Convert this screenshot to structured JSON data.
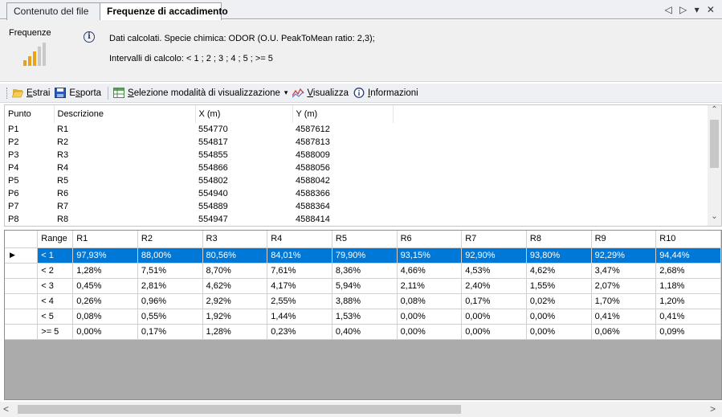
{
  "tabs": [
    {
      "label": "Contenuto del file"
    },
    {
      "label": "Frequenze di accadimento"
    }
  ],
  "tab_controls": "◁ ▷ ▾ ✕",
  "info": {
    "title": "Frequenze",
    "line1": "Dati calcolati. Specie chimica: ODOR (O.U. PeakToMean ratio: 2,3);",
    "line2": "Intervalli di calcolo: < 1 ; 2 ; 3 ; 4 ; 5 ; >= 5"
  },
  "toolbar": {
    "estrai_u": "E",
    "estrai_rest": "strai",
    "esporta_pre": "E",
    "esporta_u": "s",
    "esporta_rest": "porta",
    "selezione_u": "S",
    "selezione_rest": "elezione modalità di visualizzazione",
    "dropdown_arrow": "▾",
    "visualizza_u": "V",
    "visualizza_rest": "isualizza",
    "informazioni_u": "I",
    "informazioni_rest": "nformazioni"
  },
  "points": {
    "headers": [
      "Punto",
      "Descrizione",
      "X (m)",
      "Y (m)"
    ],
    "rows": [
      [
        "P1",
        "R1",
        "554770",
        "4587612"
      ],
      [
        "P2",
        "R2",
        "554817",
        "4587813"
      ],
      [
        "P3",
        "R3",
        "554855",
        "4588009"
      ],
      [
        "P4",
        "R4",
        "554866",
        "4588056"
      ],
      [
        "P5",
        "R5",
        "554802",
        "4588042"
      ],
      [
        "P6",
        "R6",
        "554940",
        "4588366"
      ],
      [
        "P7",
        "R7",
        "554889",
        "4588364"
      ],
      [
        "P8",
        "R8",
        "554947",
        "4588414"
      ]
    ]
  },
  "freq": {
    "headers": [
      "Range",
      "R1",
      "R2",
      "R3",
      "R4",
      "R5",
      "R6",
      "R7",
      "R8",
      "R9",
      "R10"
    ],
    "selected_marker": "▶",
    "rows": [
      [
        "< 1",
        "97,93%",
        "88,00%",
        "80,56%",
        "84,01%",
        "79,90%",
        "93,15%",
        "92,90%",
        "93,80%",
        "92,29%",
        "94,44%"
      ],
      [
        "< 2",
        "1,28%",
        "7,51%",
        "8,70%",
        "7,61%",
        "8,36%",
        "4,66%",
        "4,53%",
        "4,62%",
        "3,47%",
        "2,68%"
      ],
      [
        "< 3",
        "0,45%",
        "2,81%",
        "4,62%",
        "4,17%",
        "5,94%",
        "2,11%",
        "2,40%",
        "1,55%",
        "2,07%",
        "1,18%"
      ],
      [
        "< 4",
        "0,26%",
        "0,96%",
        "2,92%",
        "2,55%",
        "3,88%",
        "0,08%",
        "0,17%",
        "0,02%",
        "1,70%",
        "1,20%"
      ],
      [
        "< 5",
        "0,08%",
        "0,55%",
        "1,92%",
        "1,44%",
        "1,53%",
        "0,00%",
        "0,00%",
        "0,00%",
        "0,41%",
        "0,41%"
      ],
      [
        ">= 5",
        "0,00%",
        "0,17%",
        "1,28%",
        "0,23%",
        "0,40%",
        "0,00%",
        "0,00%",
        "0,00%",
        "0,06%",
        "0,09%"
      ]
    ]
  },
  "scroll": {
    "up": "⌃",
    "down": "⌄",
    "left": "<",
    "right": ">"
  },
  "colors": {
    "selection": "#0078d7",
    "signal_bars": "#e8a21b"
  }
}
